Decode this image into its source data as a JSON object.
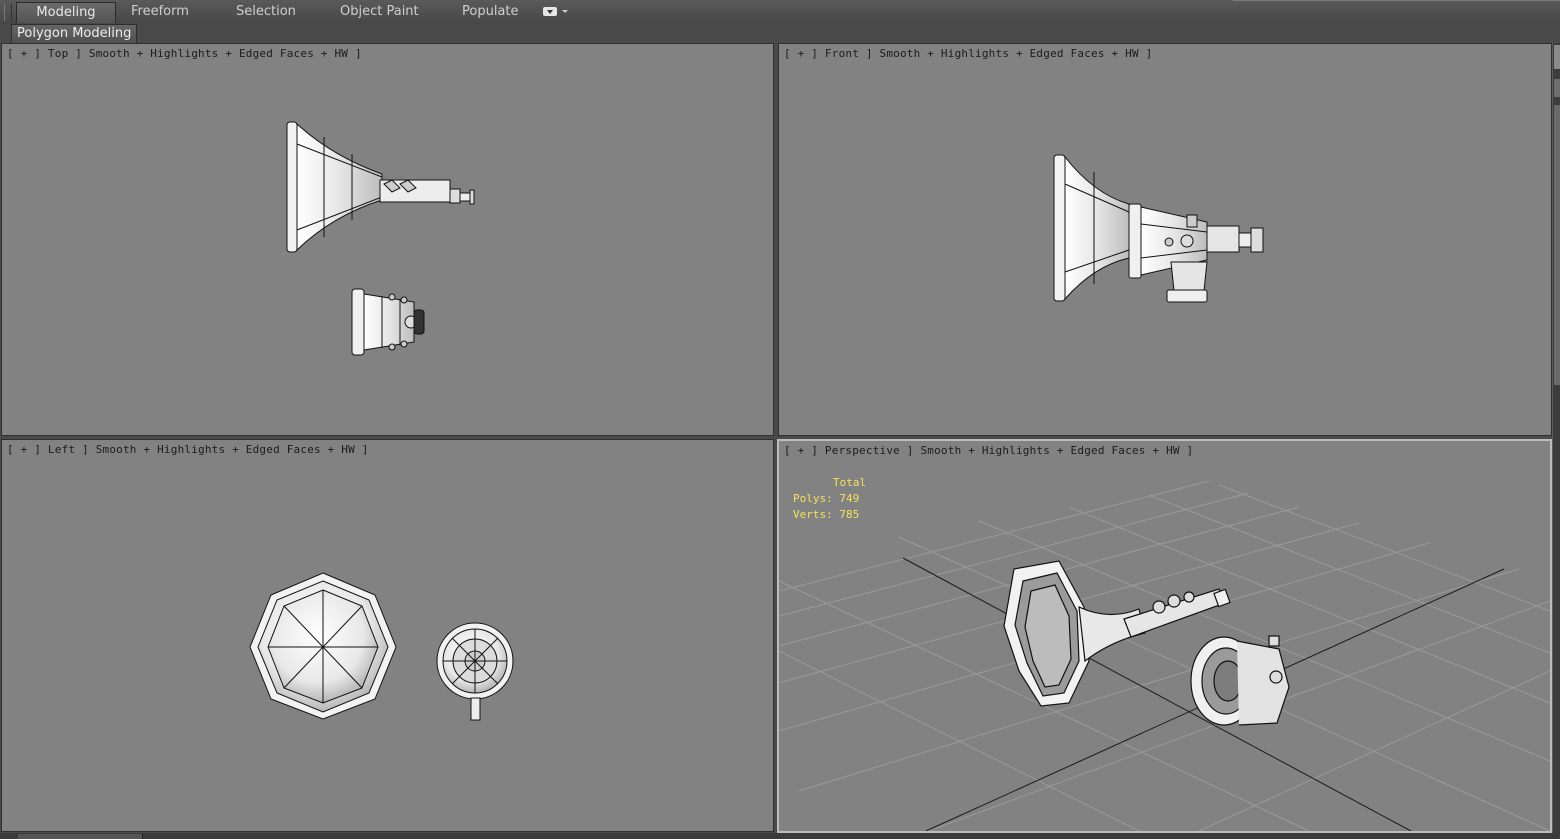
{
  "ribbon": {
    "tabs": [
      {
        "label": "Modeling",
        "active": true
      },
      {
        "label": "Freeform",
        "active": false
      },
      {
        "label": "Selection",
        "active": false
      },
      {
        "label": "Object Paint",
        "active": false
      },
      {
        "label": "Populate",
        "active": false
      }
    ],
    "dropdown_icon": "ribbon-options-icon"
  },
  "subpanel": {
    "button_label": "Polygon Modeling"
  },
  "viewports": {
    "top": {
      "label": "[ + ] Top ] Smooth + Highlights + Edged Faces + HW ]"
    },
    "front": {
      "label": "[ + ] Front ] Smooth + Highlights + Edged Faces + HW ]"
    },
    "left": {
      "label": "[ + ] Left ] Smooth + Highlights + Edged Faces + HW ]"
    },
    "perspective": {
      "label": "[ + ] Perspective ] Smooth + Highlights + Edged Faces + HW ]",
      "stats": {
        "total_label": "Total",
        "polys": "Polys: 749",
        "verts": "Verts: 785"
      }
    }
  },
  "colors": {
    "viewport_bg": "#828282",
    "stats_text": "#f3e35a",
    "ui_bg": "#4a4a4a"
  }
}
